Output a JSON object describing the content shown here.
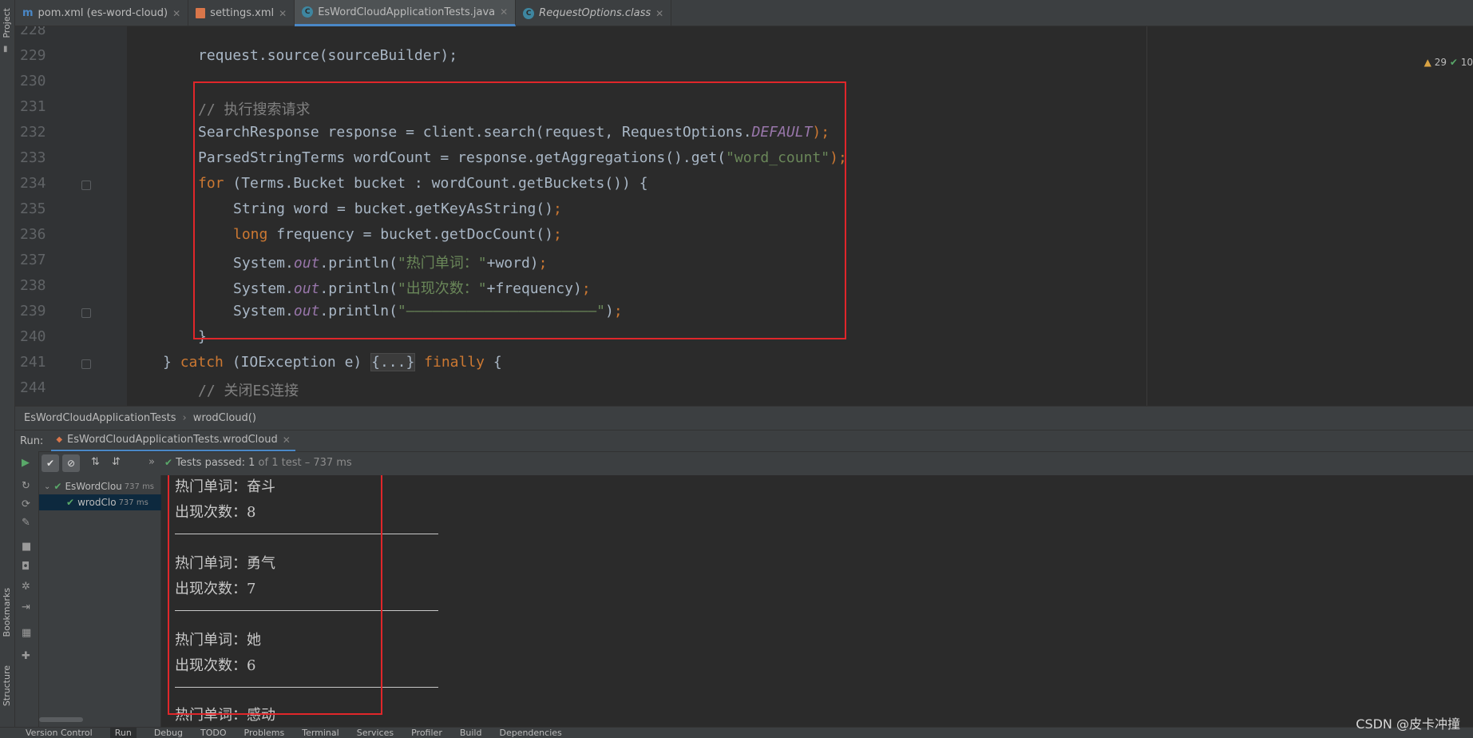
{
  "left_strip": {
    "project_label": "Project",
    "bookmarks_label": "Bookmarks",
    "structure_label": "Structure"
  },
  "tabs": [
    {
      "label": "pom.xml (es-word-cloud)",
      "icon": "maven-icon",
      "active": false
    },
    {
      "label": "settings.xml",
      "icon": "xml-icon",
      "active": false
    },
    {
      "label": "EsWordCloudApplicationTests.java",
      "icon": "java-class-icon",
      "active": true
    },
    {
      "label": "RequestOptions.class",
      "icon": "class-file-icon",
      "active": false
    }
  ],
  "inspection": {
    "warnings": "29",
    "checks": "10"
  },
  "editor": {
    "line_numbers": [
      "228",
      "229",
      "230",
      "231",
      "232",
      "233",
      "234",
      "235",
      "236",
      "237",
      "238",
      "239",
      "240",
      "241",
      "244"
    ],
    "lines": {
      "l229": "request.source(sourceBuilder);",
      "l231": "// 执行搜索请求",
      "l232a": "SearchResponse response = client.search(request, RequestOptions.",
      "l232b": "DEFAULT",
      "l232c": ");",
      "l233a": "ParsedStringTerms wordCount = response.getAggregations().get(",
      "l233b": "\"word_count\"",
      "l233c": ");",
      "l234a": "for",
      "l234b": " (Terms.Bucket bucket : wordCount.getBuckets()) {",
      "l235a": "String word = bucket.getKeyAsString()",
      "l235b": ";",
      "l236a": "long",
      "l236b": " frequency = bucket.getDocCount()",
      "l236c": ";",
      "l237a": "System.",
      "l237b": "out",
      "l237c": ".println(",
      "l237d": "\"热门单词：\"",
      "l237e": "+word)",
      "l237f": ";",
      "l238a": "System.",
      "l238b": "out",
      "l238c": ".println(",
      "l238d": "\"出现次数：\"",
      "l238e": "+frequency)",
      "l238f": ";",
      "l239a": "System.",
      "l239b": "out",
      "l239c": ".println(",
      "l239d": "\"——————————————————————\"",
      "l239e": ")",
      "l239f": ";",
      "l240": "}",
      "l241a": "} ",
      "l241b": "catch",
      "l241c": " (IOException e) ",
      "l241d": "{...}",
      "l241e": " ",
      "l241f": "finally",
      "l241g": " {",
      "l244": "// 关闭ES连接"
    }
  },
  "breadcrumb": {
    "class": "EsWordCloudApplicationTests",
    "method": "wrodCloud()"
  },
  "run": {
    "label": "Run:",
    "config": "EsWordCloudApplicationTests.wrodCloud",
    "status_text": "Tests passed:",
    "status_count": "1",
    "status_detail": "of 1 test – 737 ms"
  },
  "test_tree": [
    {
      "name": "EsWordClou",
      "time": "737 ms",
      "selected": false
    },
    {
      "name": "wrodClo",
      "time": "737 ms",
      "selected": true
    }
  ],
  "console_output": [
    {
      "word_label": "热门单词：奋斗",
      "count_label": "出现次数：8"
    },
    {
      "word_label": "热门单词：勇气",
      "count_label": "出现次数：7"
    },
    {
      "word_label": "热门单词：她",
      "count_label": "出现次数：6"
    },
    {
      "word_label": "热门单词：感动",
      "count_label": ""
    }
  ],
  "status_tabs": [
    "Version Control",
    "Run",
    "Debug",
    "TODO",
    "Problems",
    "Terminal",
    "Services",
    "Profiler",
    "Build",
    "Dependencies"
  ],
  "watermark": "CSDN @皮卡冲撞",
  "colors": {
    "keyword": "#cc7832",
    "string": "#6a8759",
    "comment": "#808080",
    "static_field": "#9876aa",
    "highlight_box": "#e0262a",
    "passed": "#59a869"
  }
}
